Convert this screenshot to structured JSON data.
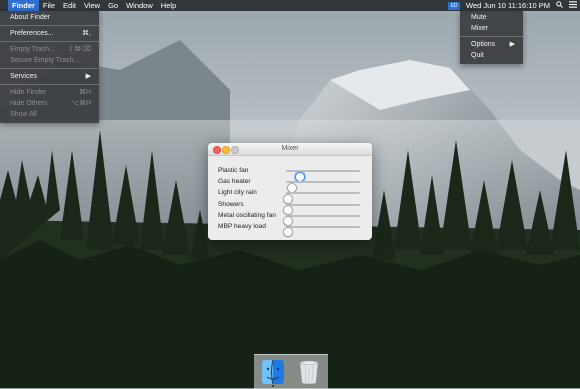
{
  "menubar": {
    "apple_glyph": "",
    "items": [
      "Finder",
      "File",
      "Edit",
      "View",
      "Go",
      "Window",
      "Help"
    ],
    "status_icon": "ED",
    "clock": "Wed Jun 10  11:16:10 PM"
  },
  "finder_menu": {
    "items": [
      {
        "label": "About Finder",
        "shortcut": "",
        "disabled": false
      },
      {
        "label": "Preferences...",
        "shortcut": "⌘,",
        "disabled": false
      },
      {
        "label": "Empty Trash...",
        "shortcut": "⇧⌘⌫",
        "disabled": true
      },
      {
        "label": "Secure Empty Trash...",
        "shortcut": "",
        "disabled": true
      },
      {
        "label": "Services",
        "shortcut": "▶",
        "disabled": false
      },
      {
        "label": "Hide Finder",
        "shortcut": "⌘H",
        "disabled": true
      },
      {
        "label": "Hide Others",
        "shortcut": "⌥⌘H",
        "disabled": true
      },
      {
        "label": "Show All",
        "shortcut": "",
        "disabled": true
      }
    ]
  },
  "status_menu": {
    "items": [
      {
        "label": "Mute",
        "shortcut": ""
      },
      {
        "label": "Mixer",
        "shortcut": ""
      },
      {
        "label": "Options",
        "shortcut": "▶"
      },
      {
        "label": "Quit",
        "shortcut": ""
      }
    ]
  },
  "mixer": {
    "title": "Mixer",
    "channels": [
      {
        "label": "Plastic fan",
        "level": 0.18
      },
      {
        "label": "Gas heater",
        "level": 0.07
      },
      {
        "label": "Light city rain",
        "level": 0.01
      },
      {
        "label": "Showers",
        "level": 0.01
      },
      {
        "label": "Metal oscillating fan",
        "level": 0.01
      },
      {
        "label": "MBP heavy load",
        "level": 0.01
      }
    ]
  },
  "colors": {
    "menu_highlight": "#2f6fd0",
    "menubar_bg": "#282c30",
    "close_button": "#fc5f57",
    "minimize_button": "#fdbc2e"
  },
  "dock": {
    "icons": [
      "finder-icon",
      "trash-icon"
    ]
  }
}
